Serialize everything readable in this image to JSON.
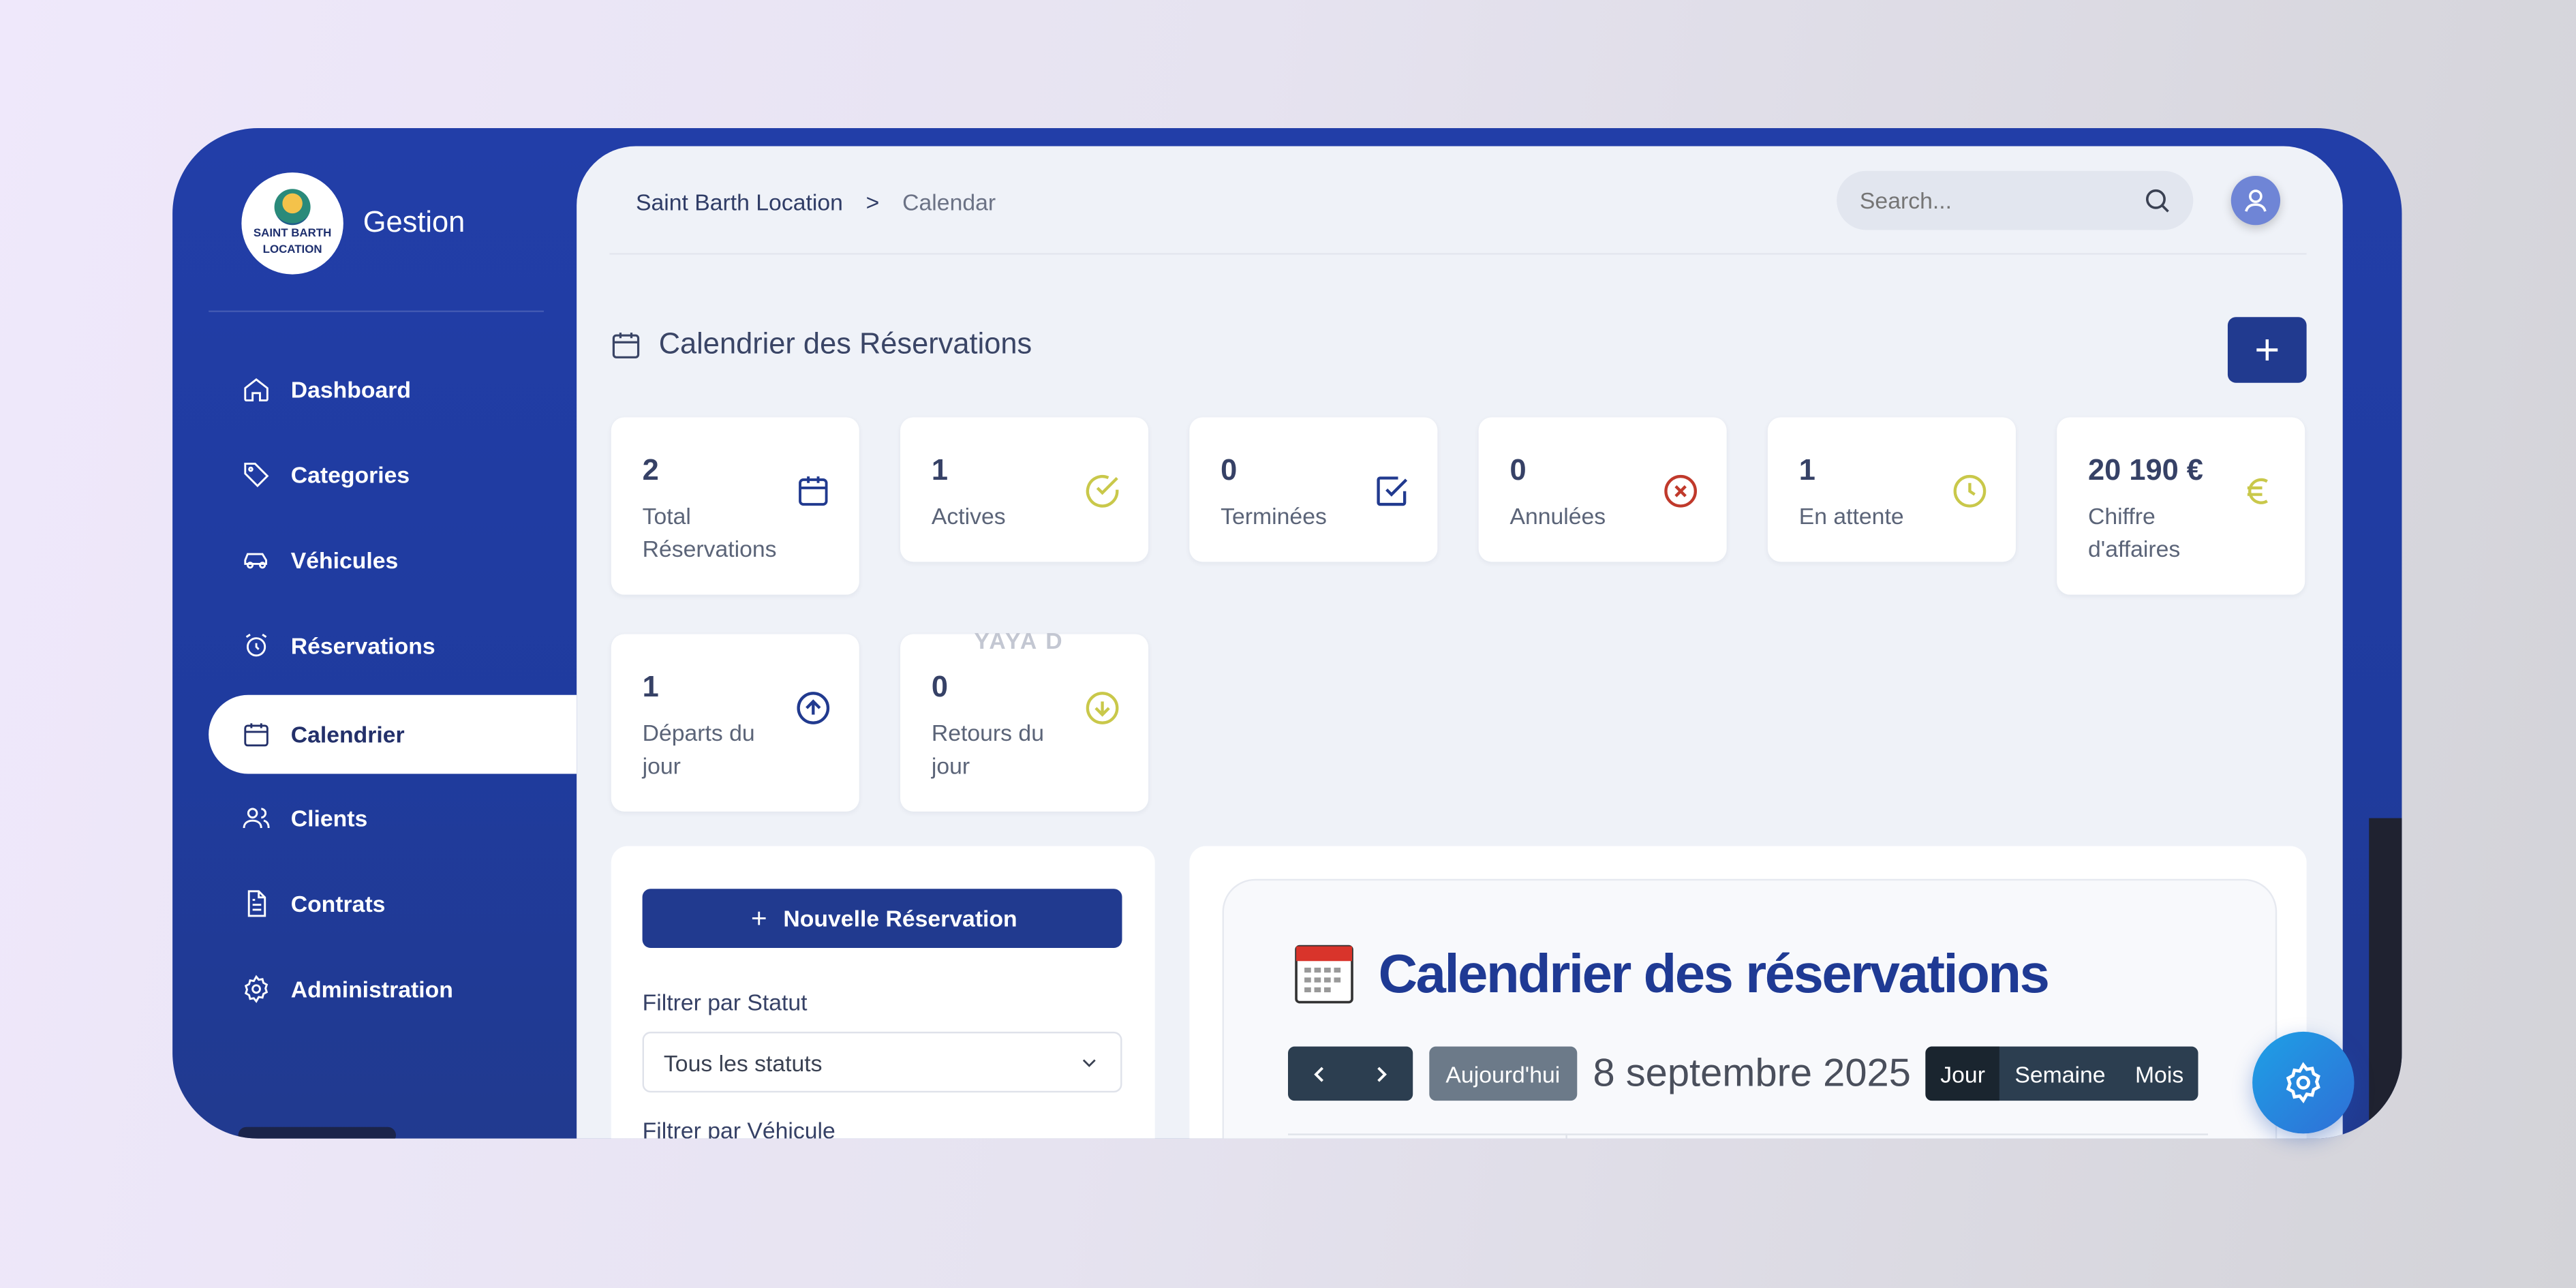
{
  "brand": {
    "logo_text_line1": "SAINT BARTH",
    "logo_text_line2": "LOCATION",
    "app_name": "Gestion"
  },
  "sidebar": {
    "items": [
      {
        "label": "Dashboard",
        "icon": "home-icon"
      },
      {
        "label": "Categories",
        "icon": "tag-icon"
      },
      {
        "label": "Véhicules",
        "icon": "car-icon"
      },
      {
        "label": "Réservations",
        "icon": "alarm-clock-icon"
      },
      {
        "label": "Calendrier",
        "icon": "calendar-icon",
        "active": true
      },
      {
        "label": "Clients",
        "icon": "users-icon"
      },
      {
        "label": "Contrats",
        "icon": "document-icon"
      },
      {
        "label": "Administration",
        "icon": "gear-icon"
      }
    ]
  },
  "header": {
    "breadcrumb": {
      "root": "Saint Barth Location",
      "separator": ">",
      "current": "Calendar"
    },
    "search": {
      "placeholder": "Search..."
    }
  },
  "page": {
    "title": "Calendrier des Réservations"
  },
  "stats": [
    {
      "value": "2",
      "label": "Total Réservations",
      "icon": "calendar-icon",
      "color": "#213a8f"
    },
    {
      "value": "1",
      "label": "Actives",
      "icon": "check-circle-icon",
      "color": "#c9c84a"
    },
    {
      "value": "0",
      "label": "Terminées",
      "icon": "check-square-icon",
      "color": "#213a8f"
    },
    {
      "value": "0",
      "label": "Annulées",
      "icon": "x-circle-icon",
      "color": "#c0392b"
    },
    {
      "value": "1",
      "label": "En attente",
      "icon": "clock-icon",
      "color": "#c9c84a"
    },
    {
      "value": "20 190 €",
      "label": "Chiffre d'affaires",
      "icon": "euro-icon",
      "color": "#c9c84a"
    },
    {
      "value": "1",
      "label": "Départs du jour",
      "icon": "arrow-up-circle-icon",
      "color": "#213a8f"
    },
    {
      "value": "0",
      "label": "Retours du jour",
      "icon": "arrow-down-circle-icon",
      "color": "#c9c84a"
    }
  ],
  "watermark": "YAYA D",
  "filters": {
    "new_button": "Nouvelle Réservation",
    "status_label": "Filtrer par Statut",
    "status_value": "Tous les statuts",
    "vehicle_label": "Filtrer par Véhicule"
  },
  "calendar": {
    "title": "Calendrier des réservations",
    "today_button": "Aujourd'hui",
    "current_date": "8 septembre 2025",
    "views": [
      "Jour",
      "Semaine",
      "Mois"
    ],
    "active_view": "Jour"
  },
  "colors": {
    "primary": "#213a8f",
    "sidebar": "#223ea8",
    "accent_yellow": "#c9c84a",
    "danger": "#c0392b",
    "fab": "#1ea0e6"
  }
}
